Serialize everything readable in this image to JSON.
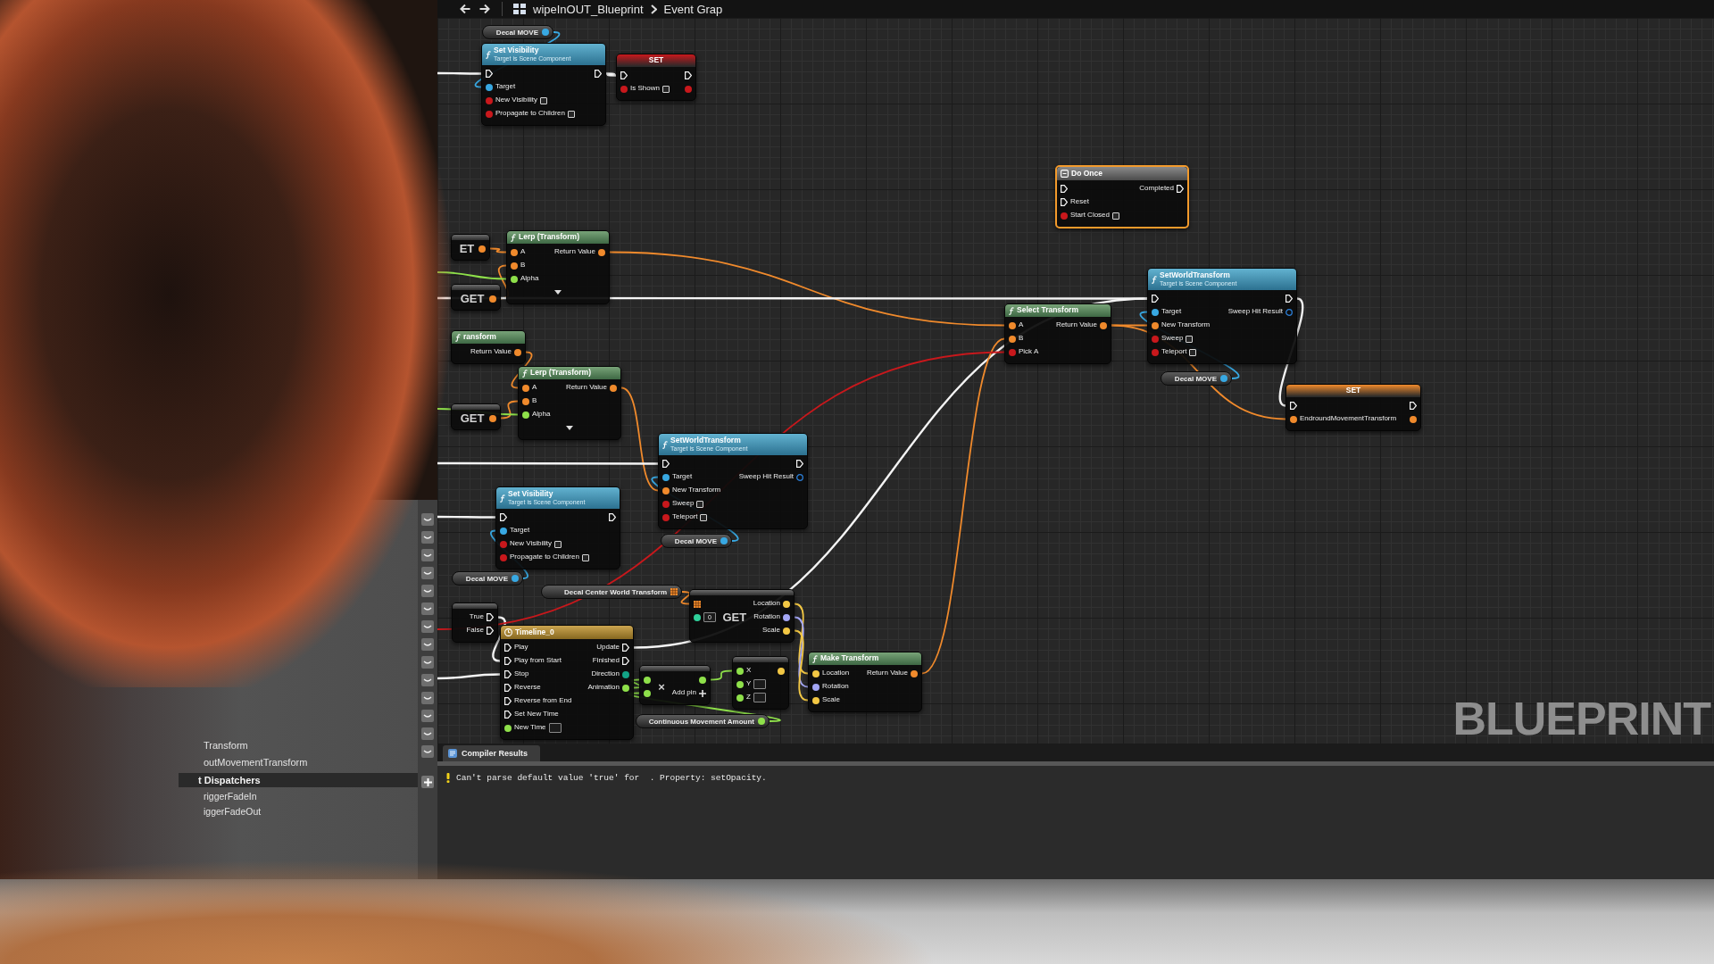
{
  "toolbar": {
    "title": "wipeInOUT_Blueprint",
    "breadcrumb": "Event Grap"
  },
  "graph": {
    "label": "BLUEPRINT",
    "nodes": [
      {
        "kind": "getter",
        "title": "Decal MOVE",
        "selected": false,
        "outputs": [
          {
            "kind": "object"
          }
        ]
      },
      {
        "kind": "function",
        "title": "Set Visibility",
        "subtitle": "Target is Scene Component",
        "selected": false,
        "inputs": [
          {
            "kind": "exec"
          },
          {
            "kind": "object",
            "label": "Target"
          },
          {
            "kind": "bool",
            "label": "New Visibility",
            "checked": false
          },
          {
            "kind": "bool",
            "label": "Propagate to Children",
            "checked": false
          }
        ],
        "outputs": [
          {
            "kind": "exec"
          }
        ]
      },
      {
        "kind": "set",
        "title": "SET",
        "selected": false,
        "inputs": [
          {
            "kind": "exec"
          },
          {
            "kind": "bool",
            "label": "Is Shown",
            "checked": false
          }
        ],
        "outputs": [
          {
            "kind": "exec"
          },
          {
            "kind": "bool"
          }
        ]
      },
      {
        "kind": "macro",
        "title": "Do Once",
        "selected": true,
        "inputs": [
          {
            "kind": "exec"
          },
          {
            "kind": "exec",
            "label": "Reset"
          },
          {
            "kind": "bool",
            "label": "Start Closed",
            "checked": false
          }
        ],
        "outputs": [
          {
            "kind": "exec",
            "label": "Completed"
          }
        ]
      },
      {
        "kind": "compact",
        "title": "ET",
        "selected": false,
        "outputs": [
          {
            "kind": "transform"
          }
        ]
      },
      {
        "kind": "compact",
        "title": "GET",
        "selected": false,
        "outputs": [
          {
            "kind": "transform"
          }
        ]
      },
      {
        "kind": "pure",
        "title": "Lerp (Transform)",
        "selected": false,
        "advanced_toggle": true,
        "inputs": [
          {
            "kind": "transform",
            "label": "A"
          },
          {
            "kind": "transform",
            "label": "B"
          },
          {
            "kind": "float",
            "label": "Alpha"
          }
        ],
        "outputs": [
          {
            "kind": "transform",
            "label": "Return Value"
          }
        ]
      },
      {
        "kind": "pure",
        "title": "ransform",
        "selected": false,
        "outputs": [
          {
            "kind": "transform",
            "label": "Return Value"
          }
        ]
      },
      {
        "kind": "pure",
        "title": "Select Transform",
        "selected": false,
        "inputs": [
          {
            "kind": "transform",
            "label": "A"
          },
          {
            "kind": "transform",
            "label": "B"
          },
          {
            "kind": "bool",
            "label": "Pick A"
          }
        ],
        "outputs": [
          {
            "kind": "transform",
            "label": "Return Value"
          }
        ]
      },
      {
        "kind": "function",
        "title": "SetWorldTransform",
        "subtitle": "Target is Scene Component",
        "selected": false,
        "inputs": [
          {
            "kind": "exec"
          },
          {
            "kind": "object",
            "label": "Target"
          },
          {
            "kind": "transform",
            "label": "New Transform"
          },
          {
            "kind": "bool",
            "label": "Sweep",
            "checked": false
          },
          {
            "kind": "bool",
            "label": "Teleport",
            "checked": false
          }
        ],
        "outputs": [
          {
            "kind": "exec"
          },
          {
            "kind": "struct",
            "label": "Sweep Hit Result"
          }
        ]
      },
      {
        "kind": "compact",
        "title": "GET",
        "selected": false,
        "outputs": [
          {
            "kind": "transform"
          }
        ]
      },
      {
        "kind": "pure",
        "title": "Lerp (Transform)",
        "selected": false,
        "advanced_toggle": true,
        "inputs": [
          {
            "kind": "transform",
            "label": "A"
          },
          {
            "kind": "transform",
            "label": "B"
          },
          {
            "kind": "float",
            "label": "Alpha"
          }
        ],
        "outputs": [
          {
            "kind": "transform",
            "label": "Return Value"
          }
        ]
      },
      {
        "kind": "getter",
        "title": "Decal MOVE",
        "selected": false,
        "outputs": [
          {
            "kind": "object"
          }
        ]
      },
      {
        "kind": "set",
        "title": "SET",
        "selected": false,
        "inputs": [
          {
            "kind": "exec"
          },
          {
            "kind": "transform",
            "label": "EndroundMovementTransform"
          }
        ],
        "outputs": [
          {
            "kind": "exec"
          },
          {
            "kind": "transform"
          }
        ]
      },
      {
        "kind": "function",
        "title": "Set Visibility",
        "subtitle": "Target is Scene Component",
        "selected": false,
        "inputs": [
          {
            "kind": "exec"
          },
          {
            "kind": "object",
            "label": "Target"
          },
          {
            "kind": "bool",
            "label": "New Visibility",
            "checked": false
          },
          {
            "kind": "bool",
            "label": "Propagate to Children",
            "checked": false
          }
        ],
        "outputs": [
          {
            "kind": "exec"
          }
        ]
      },
      {
        "kind": "function",
        "title": "SetWorldTransform",
        "subtitle": "Target is Scene Component",
        "selected": false,
        "inputs": [
          {
            "kind": "exec"
          },
          {
            "kind": "object",
            "label": "Target"
          },
          {
            "kind": "transform",
            "label": "New Transform"
          },
          {
            "kind": "bool",
            "label": "Sweep",
            "checked": false
          },
          {
            "kind": "bool",
            "label": "Teleport",
            "checked": false
          }
        ],
        "outputs": [
          {
            "kind": "exec"
          },
          {
            "kind": "struct",
            "label": "Sweep Hit Result"
          }
        ]
      },
      {
        "kind": "getter",
        "title": "Decal MOVE",
        "selected": false,
        "outputs": [
          {
            "kind": "object"
          }
        ]
      },
      {
        "kind": "getter",
        "title": "Decal MOVE",
        "selected": false,
        "outputs": [
          {
            "kind": "object"
          }
        ]
      },
      {
        "kind": "getter",
        "title": "Decal Center World Transform",
        "selected": false,
        "outputs": [
          {
            "kind": "array"
          }
        ]
      },
      {
        "kind": "compact",
        "selected": false,
        "outputs": [
          {
            "kind": "exec",
            "label": "True"
          },
          {
            "kind": "exec",
            "label": "False"
          }
        ]
      },
      {
        "kind": "timeline",
        "title": "Timeline_0",
        "selected": false,
        "inputs": [
          {
            "kind": "exec",
            "label": "Play"
          },
          {
            "kind": "exec",
            "label": "Play from Start"
          },
          {
            "kind": "exec",
            "label": "Stop"
          },
          {
            "kind": "exec",
            "label": "Reverse"
          },
          {
            "kind": "exec",
            "label": "Reverse from End"
          },
          {
            "kind": "exec",
            "label": "Set New Time"
          },
          {
            "kind": "float",
            "label": "New Time",
            "field": true
          }
        ],
        "outputs": [
          {
            "kind": "exec",
            "label": "Update"
          },
          {
            "kind": "exec",
            "label": "Finished"
          },
          {
            "kind": "enum",
            "label": "Direction"
          },
          {
            "kind": "float",
            "label": "Animation"
          }
        ]
      },
      {
        "kind": "compact",
        "title": "GET",
        "selected": false,
        "inputs": [
          {
            "kind": "array"
          },
          {
            "kind": "int",
            "field": true,
            "value": "0"
          }
        ],
        "outputs": [
          {
            "kind": "vector",
            "label": "Location"
          },
          {
            "kind": "rotator",
            "label": "Rotation"
          },
          {
            "kind": "vector",
            "label": "Scale"
          }
        ]
      },
      {
        "kind": "compact",
        "title": "×",
        "selected": false,
        "inputs": [
          {
            "kind": "float"
          },
          {
            "kind": "float"
          }
        ],
        "outputs": [
          {
            "kind": "float"
          },
          {
            "kind": "add-pin",
            "label": "Add pin"
          }
        ]
      },
      {
        "kind": "compact",
        "selected": false,
        "inputs": [
          {
            "kind": "float",
            "label": "X"
          },
          {
            "kind": "float",
            "label": "Y",
            "field": true
          },
          {
            "kind": "float",
            "label": "Z",
            "field": true
          }
        ],
        "outputs": [
          {
            "kind": "vector"
          }
        ]
      },
      {
        "kind": "pure",
        "title": "Make Transform",
        "selected": false,
        "inputs": [
          {
            "kind": "vector",
            "label": "Location"
          },
          {
            "kind": "rotator",
            "label": "Rotation"
          },
          {
            "kind": "vector",
            "label": "Scale"
          }
        ],
        "outputs": [
          {
            "kind": "transform",
            "label": "Return Value"
          }
        ]
      },
      {
        "kind": "getter",
        "title": "Continuous Movement Amount",
        "selected": false,
        "outputs": [
          {
            "kind": "float"
          }
        ]
      }
    ]
  },
  "my_blueprint": {
    "items": [
      {
        "kind": "variable",
        "label": "Transform"
      },
      {
        "kind": "variable",
        "label": "outMovementTransform"
      },
      {
        "kind": "category",
        "label": "t Dispatchers"
      },
      {
        "kind": "dispatcher",
        "label": "riggerFadeIn"
      },
      {
        "kind": "dispatcher",
        "label": "iggerFadeOut"
      }
    ]
  },
  "compiler_results": {
    "tab": "Compiler Results",
    "messages": [
      {
        "kind": "warning",
        "text": "Can't parse default value 'true' for  . Property: setOpacity."
      }
    ]
  }
}
